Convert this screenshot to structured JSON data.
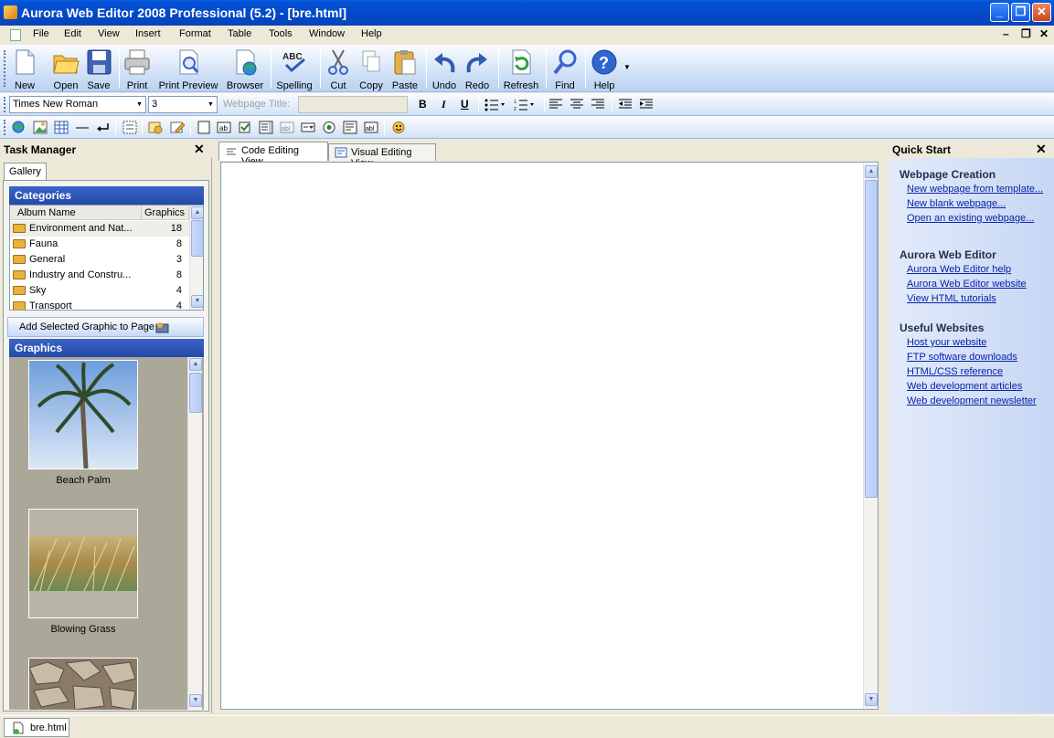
{
  "window": {
    "title": "Aurora Web Editor 2008 Professional (5.2) - [bre.html]",
    "min": "_",
    "max": "❐",
    "close": "✕"
  },
  "menu": [
    "File",
    "Edit",
    "View",
    "Insert",
    "Format",
    "Table",
    "Tools",
    "Window",
    "Help"
  ],
  "mdi": {
    "min": "–",
    "restore": "❐",
    "close": "✕"
  },
  "toolbar": [
    "New",
    "Open",
    "Save",
    "Print",
    "Print Preview",
    "Browser",
    "Spelling",
    "Cut",
    "Copy",
    "Paste",
    "Undo",
    "Redo",
    "Refresh",
    "Find",
    "Help"
  ],
  "format": {
    "font": "Times New Roman",
    "size": "3",
    "title_placeholder": "Webpage Title:",
    "bold": "B",
    "italic": "I",
    "underline": "U"
  },
  "task_manager": {
    "title": "Task Manager",
    "tab": "Gallery",
    "categories_title": "Categories",
    "col_album": "Album Name",
    "col_graphics": "Graphics",
    "categories": [
      {
        "name": "Environment and Nat...",
        "count": "18"
      },
      {
        "name": "Fauna",
        "count": "8"
      },
      {
        "name": "General",
        "count": "3"
      },
      {
        "name": "Industry and Constru...",
        "count": "8"
      },
      {
        "name": "Sky",
        "count": "4"
      },
      {
        "name": "Transport",
        "count": "4"
      }
    ],
    "add_button": "Add Selected Graphic to Page",
    "graphics_title": "Graphics",
    "graphics": [
      {
        "caption": "Beach Palm"
      },
      {
        "caption": "Blowing Grass"
      }
    ]
  },
  "editor": {
    "tab_code": "Code Editing View",
    "tab_visual": "Visual Editing View"
  },
  "quick_start": {
    "title": "Quick Start",
    "sections": [
      {
        "heading": "Webpage Creation",
        "links": [
          "New webpage from template...",
          "New blank webpage...",
          "Open an existing webpage..."
        ]
      },
      {
        "heading": "Aurora Web Editor",
        "links": [
          "Aurora Web Editor help",
          "Aurora Web Editor website",
          "View HTML tutorials"
        ]
      },
      {
        "heading": "Useful Websites",
        "links": [
          "Host your website",
          "FTP software downloads",
          "HTML/CSS reference",
          "Web development articles",
          "Web development newsletter"
        ]
      }
    ]
  },
  "status": {
    "doc_tab": "bre.html"
  },
  "colors": {
    "title_bar": "#0453D6",
    "panel_header": "#2449A8",
    "code_tag": "#000080",
    "code_attr": "#006070",
    "link": "#0A23A8"
  }
}
